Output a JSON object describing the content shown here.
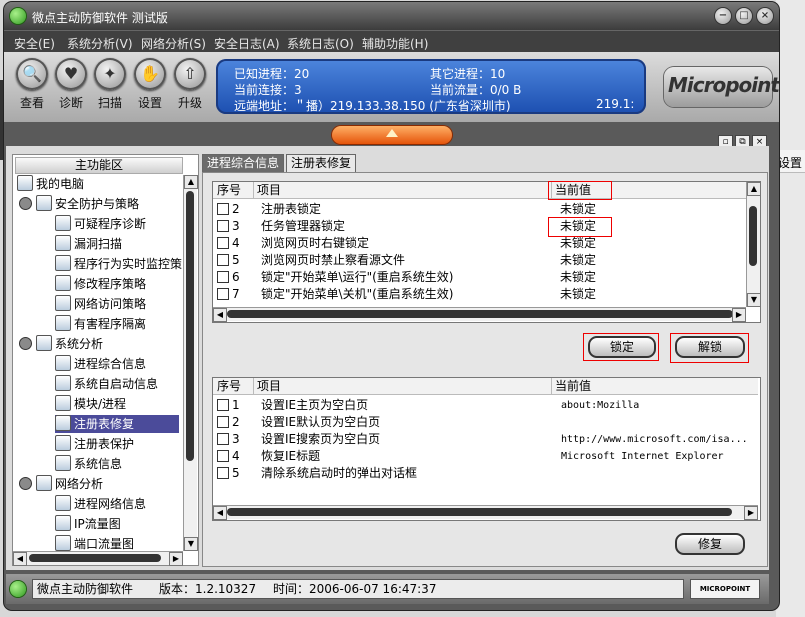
{
  "window": {
    "title": "微点主动防御软件  测试版"
  },
  "background": {
    "right_text": "设置"
  },
  "menu": [
    "安全(E)",
    "系统分析(V)",
    "网络分析(S)",
    "安全日志(A)",
    "系统日志(O)",
    "辅助功能(H)"
  ],
  "toolbar": [
    {
      "label": "查看",
      "icon": "magnifier-icon"
    },
    {
      "label": "诊断",
      "icon": "heart-icon"
    },
    {
      "label": "扫描",
      "icon": "scan-icon"
    },
    {
      "label": "设置",
      "icon": "hand-icon"
    },
    {
      "label": "升级",
      "icon": "up-arrow-icon"
    }
  ],
  "info": {
    "known_proc": "已知进程：20",
    "other_proc": "其它进程：10",
    "cur_conn": "当前连接：3",
    "cur_flow": "当前流量：0/0 B",
    "remote": "远端地址：＂播）219.133.38.150 (广东省深圳市)",
    "remote_right": "219.1:"
  },
  "logo": {
    "text": "Micropoint",
    "status_logo": "MICROPOINT"
  },
  "left_panel": {
    "header": "主功能区",
    "items": [
      {
        "label": "我的电脑",
        "level": 0
      },
      {
        "label": "安全防护与策略",
        "level": 1
      },
      {
        "label": "可疑程序诊断",
        "level": 2
      },
      {
        "label": "漏洞扫描",
        "level": 2
      },
      {
        "label": "程序行为实时监控策",
        "level": 2
      },
      {
        "label": "修改程序策略",
        "level": 2
      },
      {
        "label": "网络访问策略",
        "level": 2
      },
      {
        "label": "有害程序隔离",
        "level": 2
      },
      {
        "label": "系统分析",
        "level": 1
      },
      {
        "label": "进程综合信息",
        "level": 2
      },
      {
        "label": "系统自启动信息",
        "level": 2
      },
      {
        "label": "模块/进程",
        "level": 2
      },
      {
        "label": "注册表修复",
        "level": 2,
        "selected": true
      },
      {
        "label": "注册表保护",
        "level": 2
      },
      {
        "label": "系统信息",
        "level": 2
      },
      {
        "label": "网络分析",
        "level": 1
      },
      {
        "label": "进程网络信息",
        "level": 2
      },
      {
        "label": "IP流量图",
        "level": 2
      },
      {
        "label": "端口流量图",
        "level": 2
      }
    ]
  },
  "tabs": [
    "进程综合信息",
    "注册表修复"
  ],
  "table1": {
    "headers": [
      "序号",
      "项目",
      "当前值"
    ],
    "rows": [
      {
        "no": "2",
        "item": "注册表锁定",
        "value": "未锁定"
      },
      {
        "no": "3",
        "item": "任务管理器锁定",
        "value": "未锁定"
      },
      {
        "no": "4",
        "item": "浏览网页时右键锁定",
        "value": "未锁定"
      },
      {
        "no": "5",
        "item": "浏览网页时禁止察看源文件",
        "value": "未锁定"
      },
      {
        "no": "6",
        "item": "锁定\"开始菜单\\运行\"(重启系统生效)",
        "value": "未锁定"
      },
      {
        "no": "7",
        "item": "锁定\"开始菜单\\关机\"(重启系统生效)",
        "value": "未锁定"
      }
    ]
  },
  "buttons": {
    "lock": "锁定",
    "unlock": "解锁",
    "repair": "修复"
  },
  "table2": {
    "headers": [
      "序号",
      "项目",
      "当前值"
    ],
    "rows": [
      {
        "no": "1",
        "item": "设置IE主页为空白页",
        "value": "about:Mozilla"
      },
      {
        "no": "2",
        "item": "设置IE默认页为空白页",
        "value": ""
      },
      {
        "no": "3",
        "item": "设置IE搜索页为空白页",
        "value": "http://www.microsoft.com/isa..."
      },
      {
        "no": "4",
        "item": "恢复IE标题",
        "value": "Microsoft Internet Explorer"
      },
      {
        "no": "5",
        "item": "清除系统启动时的弹出对话框",
        "value": ""
      }
    ]
  },
  "status": {
    "app": "微点主动防御软件",
    "version": "版本：1.2.10327",
    "time": "时间：2006-06-07 16:47:37"
  }
}
